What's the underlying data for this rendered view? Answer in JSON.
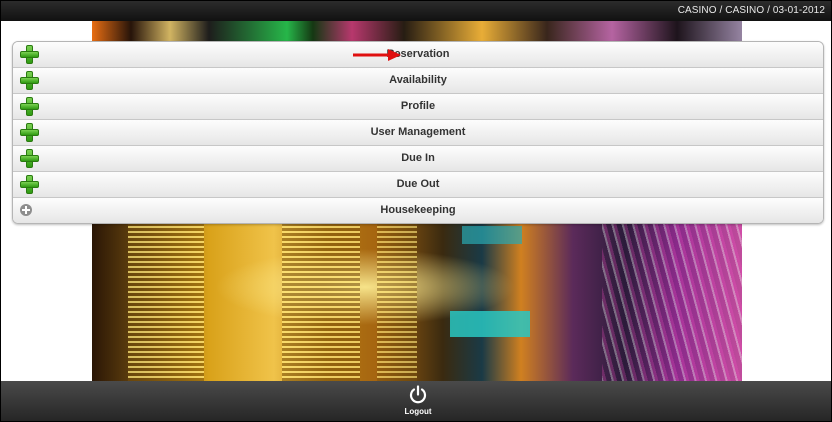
{
  "header": {
    "context": "CASINO / CASINO / 03-01-2012"
  },
  "menu": {
    "items": [
      {
        "label": "Reservation",
        "icon": "green-plus-icon"
      },
      {
        "label": "Availability",
        "icon": "green-plus-icon"
      },
      {
        "label": "Profile",
        "icon": "green-plus-icon"
      },
      {
        "label": "User Management",
        "icon": "green-plus-icon"
      },
      {
        "label": "Due In",
        "icon": "green-plus-icon"
      },
      {
        "label": "Due Out",
        "icon": "green-plus-icon"
      },
      {
        "label": "Housekeeping",
        "icon": "gray-circle-plus-icon"
      }
    ]
  },
  "footer": {
    "logout_label": "Logout",
    "logout_icon": "power-icon"
  },
  "annotation": {
    "arrow_icon": "red-arrow-icon",
    "arrow_color": "#e01010"
  },
  "colors": {
    "plus_green": "#3aa718",
    "topbar": "#1a1a1a",
    "footer": "#333333"
  }
}
